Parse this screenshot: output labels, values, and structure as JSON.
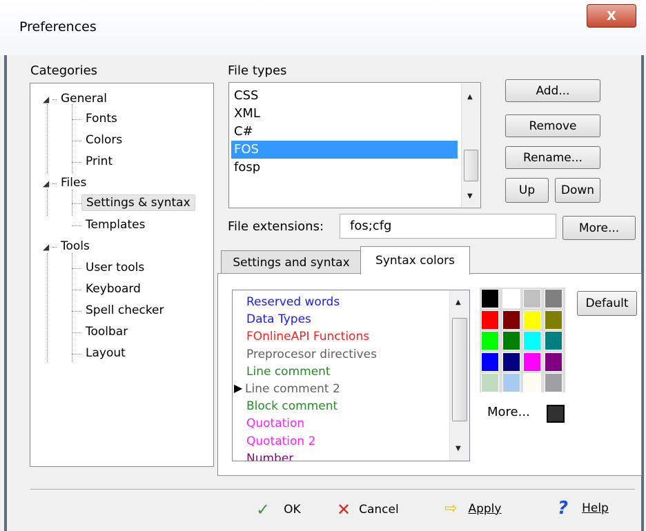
{
  "window": {
    "title": "Preferences",
    "close_glyph": "X"
  },
  "categories": {
    "label": "Categories",
    "items": [
      {
        "label": "General",
        "level": 0,
        "expanded": true
      },
      {
        "label": "Fonts",
        "level": 1
      },
      {
        "label": "Colors",
        "level": 1
      },
      {
        "label": "Print",
        "level": 1
      },
      {
        "label": "Files",
        "level": 0,
        "expanded": true
      },
      {
        "label": "Settings & syntax",
        "level": 1,
        "selected": true
      },
      {
        "label": "Templates",
        "level": 1
      },
      {
        "label": "Tools",
        "level": 0,
        "expanded": true
      },
      {
        "label": "User tools",
        "level": 1
      },
      {
        "label": "Keyboard",
        "level": 1
      },
      {
        "label": "Spell checker",
        "level": 1
      },
      {
        "label": "Toolbar",
        "level": 1
      },
      {
        "label": "Layout",
        "level": 1
      }
    ]
  },
  "file_types": {
    "label": "File types",
    "items": [
      "CSS",
      "XML",
      "C#",
      "FOS",
      "fosp"
    ],
    "selected": "FOS"
  },
  "buttons": {
    "add": "Add...",
    "remove": "Remove",
    "rename": "Rename...",
    "up": "Up",
    "down": "Down",
    "more": "More...",
    "default": "Default"
  },
  "file_extensions": {
    "label": "File extensions:",
    "value": "fos;cfg"
  },
  "tabs": [
    {
      "label": "Settings and syntax",
      "active": false
    },
    {
      "label": "Syntax colors",
      "active": true
    }
  ],
  "syntax_colors": {
    "current_marker": "▶",
    "items": [
      {
        "label": "Reserved words",
        "color": "#1a1aff"
      },
      {
        "label": "Data Types",
        "color": "#1a1aff"
      },
      {
        "label": "FOnlineAPI Functions",
        "color": "#ff2020"
      },
      {
        "label": "Preprocesor directives",
        "color": "#606060"
      },
      {
        "label": "Line comment",
        "color": "#1f8f1f"
      },
      {
        "label": "Line comment 2",
        "color": "#606060",
        "current": true
      },
      {
        "label": "Block comment",
        "color": "#1f8f1f"
      },
      {
        "label": "Quotation",
        "color": "#ff20ff"
      },
      {
        "label": "Quotation 2",
        "color": "#ff20ff"
      },
      {
        "label": "Number",
        "color": "#8b008b"
      }
    ]
  },
  "palette": {
    "rows": [
      [
        "#000000",
        "#ffffff",
        "#c0c0c0",
        "#808080"
      ],
      [
        "#ff0000",
        "#800000",
        "#ffff00",
        "#808000"
      ],
      [
        "#00ff00",
        "#008000",
        "#00ffff",
        "#008080"
      ],
      [
        "#0000ff",
        "#000080",
        "#ff00ff",
        "#800080"
      ],
      [
        "#c0dcc0",
        "#a6caf0",
        "#fffbf0",
        "#a0a0a4"
      ]
    ],
    "more_label": "More...",
    "current_color": "#303030"
  },
  "footer": {
    "ok": "OK",
    "cancel": "Cancel",
    "apply": "Apply",
    "help": "Help"
  }
}
